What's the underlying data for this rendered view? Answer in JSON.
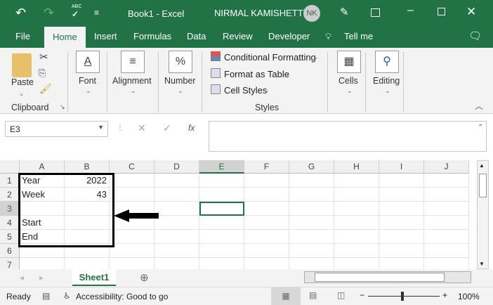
{
  "title_bar": {
    "doc_title": "Book1  -  Excel",
    "user_name": "NIRMAL KAMISHETTY",
    "avatar_initials": "NK",
    "spell_label": "ABC"
  },
  "tabs": [
    "File",
    "Home",
    "Insert",
    "Formulas",
    "Data",
    "Review",
    "Developer"
  ],
  "tell_me": "Tell me",
  "ribbon": {
    "paste": "Paste",
    "clipboard": "Clipboard",
    "font": "Font",
    "alignment": "Alignment",
    "number": "Number",
    "number_icon": "%",
    "font_icon": "A",
    "conditional_formatting": "Conditional Formatting",
    "format_as_table": "Format as Table",
    "cell_styles": "Cell Styles",
    "styles": "Styles",
    "cells": "Cells",
    "editing": "Editing"
  },
  "formula_bar": {
    "name_box": "E3",
    "fx": "fx",
    "value": ""
  },
  "columns": [
    "A",
    "B",
    "C",
    "D",
    "E",
    "F",
    "G",
    "H",
    "I",
    "J"
  ],
  "rows": [
    "1",
    "2",
    "3",
    "4",
    "5",
    "6",
    "7"
  ],
  "cells": {
    "A1": "Year",
    "B1": "2022",
    "A2": "Week",
    "B2": "43",
    "A4": "Start",
    "A5": "End"
  },
  "selected_cell": "E3",
  "sheet_tab": "Sheet1",
  "status": {
    "ready": "Ready",
    "accessibility": "Accessibility: Good to go",
    "zoom": "100%"
  },
  "colors": {
    "brand": "#217346",
    "annotation": "#000000"
  }
}
